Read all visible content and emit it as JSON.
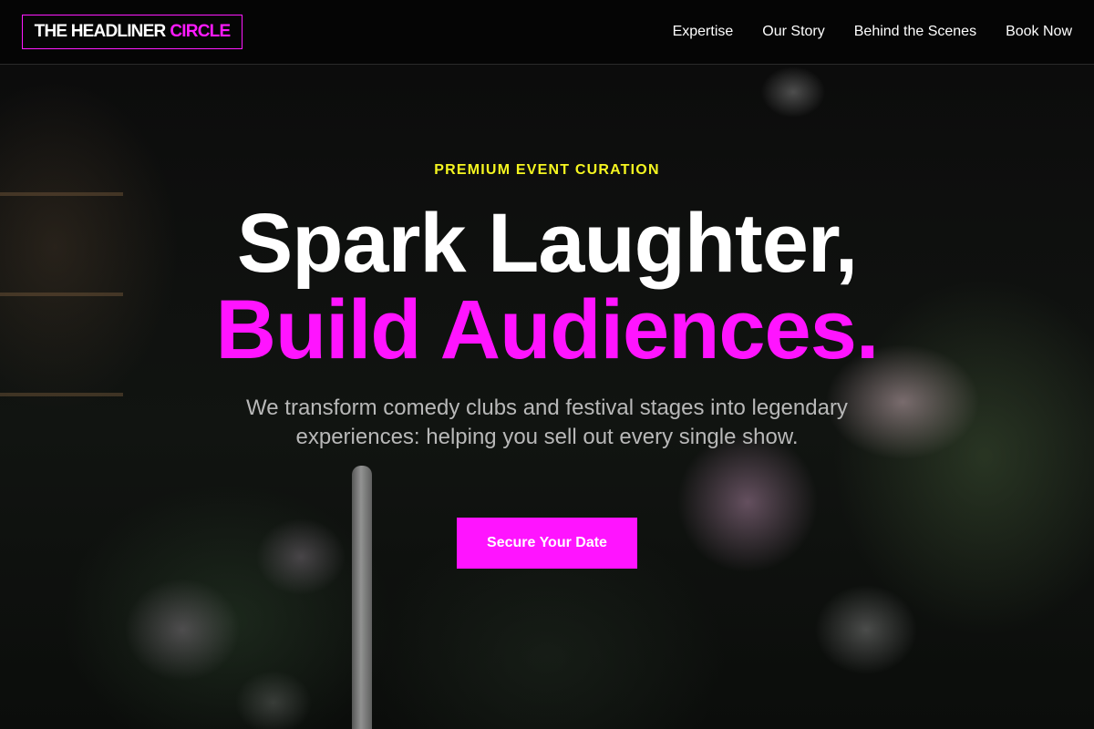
{
  "header": {
    "logo_primary": "THE HEADLINER",
    "logo_accent": "CIRCLE",
    "nav": [
      {
        "label": "Expertise"
      },
      {
        "label": "Our Story"
      },
      {
        "label": "Behind the Scenes"
      },
      {
        "label": "Book Now"
      }
    ]
  },
  "hero": {
    "eyebrow": "PREMIUM EVENT CURATION",
    "title_line_1": "Spark Laughter,",
    "title_line_2": "Build Audiences.",
    "subtitle": "We transform comedy clubs and festival stages into legendary experiences: helping you sell out every single show.",
    "cta_label": "Secure Your Date"
  },
  "colors": {
    "accent": "#ff14ff",
    "eyebrow": "#f5f520",
    "background": "#000000"
  }
}
